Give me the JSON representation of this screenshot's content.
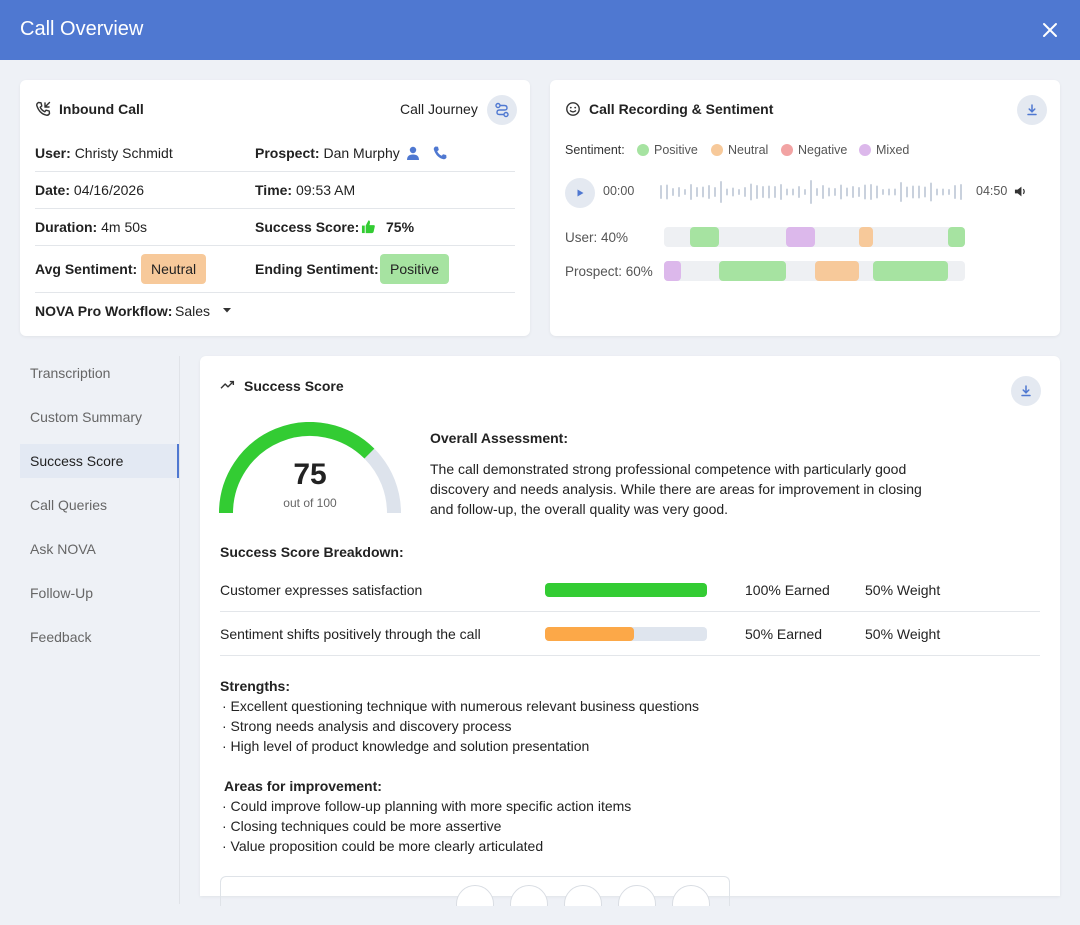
{
  "window": {
    "title": "Call Overview"
  },
  "call_card": {
    "title": "Inbound Call",
    "journey_label": "Call Journey",
    "user_label": "User:",
    "user_value": "Christy Schmidt",
    "prospect_label": "Prospect:",
    "prospect_value": "Dan Murphy",
    "date_label": "Date:",
    "date_value": "04/16/2026",
    "time_label": "Time:",
    "time_value": "09:53 AM",
    "duration_label": "Duration:",
    "duration_value": "4m 50s",
    "success_label": "Success Score:",
    "success_value": "75%",
    "avg_sentiment_label": "Avg Sentiment:",
    "avg_sentiment_value": "Neutral",
    "ending_sentiment_label": "Ending Sentiment:",
    "ending_sentiment_value": "Positive",
    "workflow_label": "NOVA Pro Workflow:",
    "workflow_value": "Sales"
  },
  "recording_card": {
    "title": "Call Recording & Sentiment",
    "sentiment_label": "Sentiment:",
    "legend": [
      {
        "label": "Positive",
        "color": "#a6e3a1"
      },
      {
        "label": "Neutral",
        "color": "#f7c99a"
      },
      {
        "label": "Negative",
        "color": "#f2a3a3"
      },
      {
        "label": "Mixed",
        "color": "#dcb8eb"
      }
    ],
    "time_start": "00:00",
    "time_end": "04:50",
    "user_track_label": "User: 40%",
    "prospect_track_label": "Prospect: 60%"
  },
  "sidebar": {
    "items": [
      {
        "label": "Transcription"
      },
      {
        "label": "Custom Summary"
      },
      {
        "label": "Success Score"
      },
      {
        "label": "Call Queries"
      },
      {
        "label": "Ask NOVA"
      },
      {
        "label": "Follow-Up"
      },
      {
        "label": "Feedback"
      }
    ],
    "active_index": 2
  },
  "score_card": {
    "title": "Success Score",
    "score": "75",
    "score_fraction": 0.75,
    "out_of": "out of 100",
    "assessment_title": "Overall Assessment:",
    "assessment_lines": [
      "The call demonstrated strong professional competence with particularly good",
      "discovery and needs analysis. While there are areas for improvement in closing",
      "and follow-up, the overall quality was very good."
    ],
    "breakdown_title": "Success Score Breakdown:",
    "breakdown": [
      {
        "criterion": "Customer expresses satisfaction",
        "earned": "100% Earned",
        "weight": "50% Weight",
        "fraction": 1.0,
        "color": "#33cc33"
      },
      {
        "criterion": "Sentiment shifts positively through the call",
        "earned": "50% Earned",
        "weight": "50% Weight",
        "fraction": 0.55,
        "color": "#fca848"
      }
    ],
    "strengths_title": "Strengths:",
    "strengths": [
      "· Excellent questioning technique with numerous relevant business questions",
      "· Strong needs analysis and discovery process",
      "· High level of product knowledge and solution presentation"
    ],
    "improve_title": "Areas for improvement:",
    "improvements": [
      "· Could improve follow-up planning with more specific action items",
      "· Closing techniques could be more assertive",
      "· Value proposition could be more clearly articulated"
    ]
  },
  "colors": {
    "header": "#4f78d1",
    "positive": "#a6e3a1",
    "neutral": "#f7c99a",
    "negative": "#f2a3a3",
    "mixed": "#dcb8eb",
    "gauge": "#33cc33",
    "accent": "#4f78d1"
  }
}
